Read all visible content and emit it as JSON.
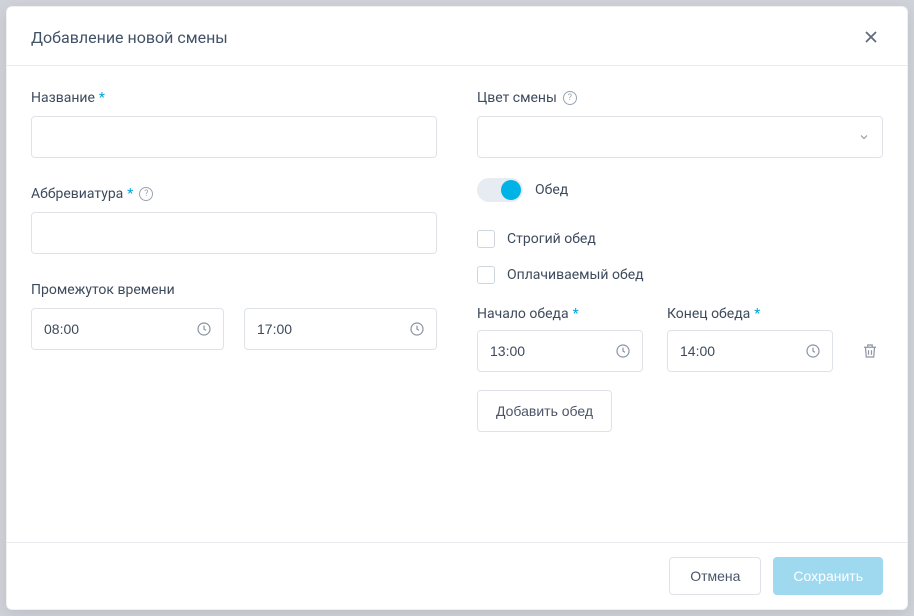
{
  "modal": {
    "title": "Добавление новой смены"
  },
  "left": {
    "name_label": "Название",
    "abbr_label": "Аббревиатура",
    "timerange_label": "Промежуток времени",
    "time_start": "08:00",
    "time_end": "17:00"
  },
  "right": {
    "color_label": "Цвет смены",
    "lunch_toggle_label": "Обед",
    "strict_lunch_label": "Строгий обед",
    "paid_lunch_label": "Оплачиваемый обед",
    "lunch_start_label": "Начало обеда",
    "lunch_end_label": "Конец обеда",
    "lunch_start": "13:00",
    "lunch_end": "14:00",
    "add_lunch_label": "Добавить обед"
  },
  "footer": {
    "cancel": "Отмена",
    "save": "Сохранить"
  }
}
